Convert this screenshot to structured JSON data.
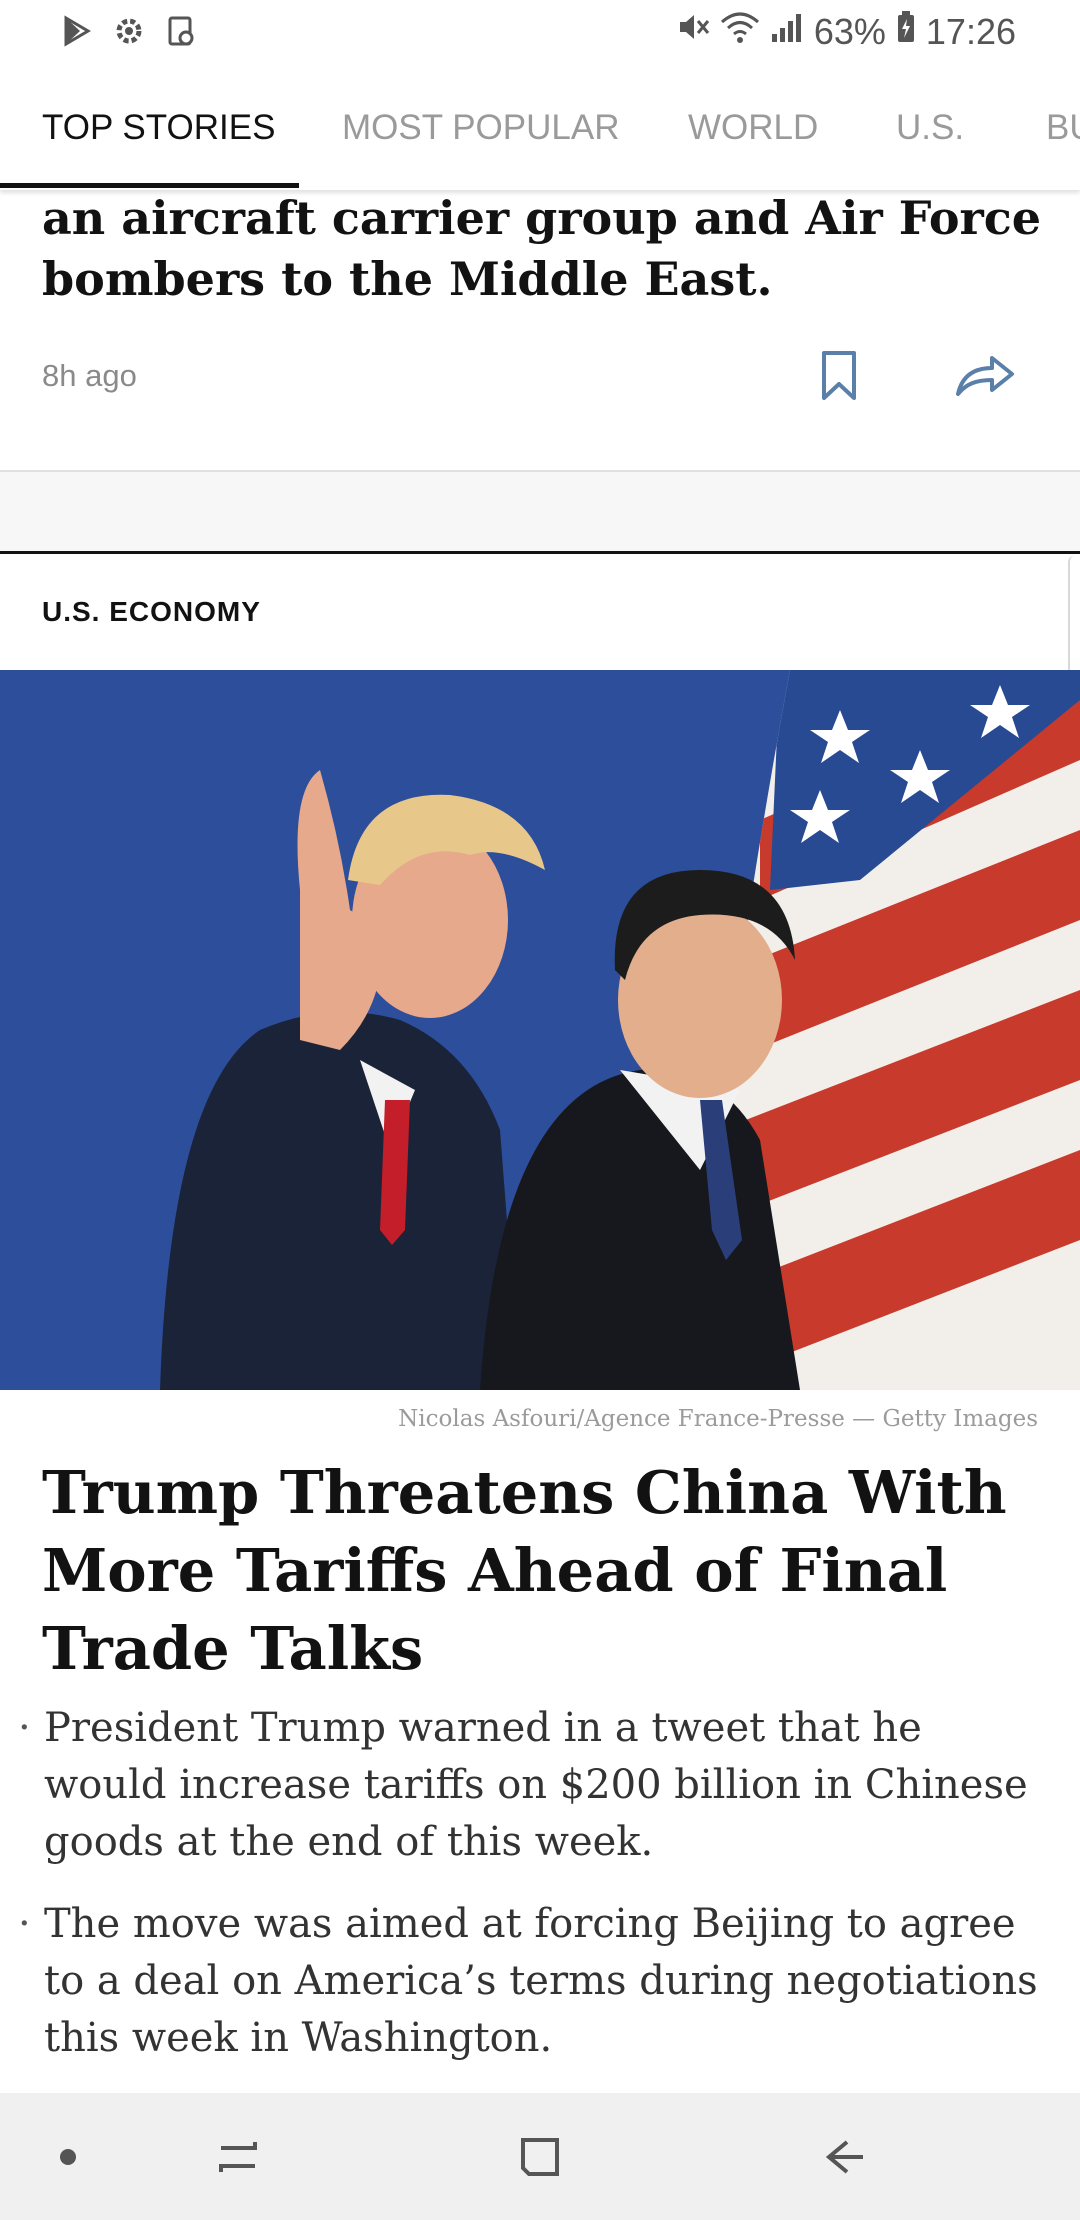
{
  "status_bar": {
    "left_icons": [
      "play-store-icon",
      "settings-gear-icon",
      "file-icon"
    ],
    "right_icons": [
      "mute-icon",
      "wifi-icon",
      "signal-icon"
    ],
    "battery": "63%",
    "time": "17:26"
  },
  "tabs": [
    {
      "label": "TOP STORIES",
      "active": true
    },
    {
      "label": "MOST POPULAR",
      "active": false
    },
    {
      "label": "WORLD",
      "active": false
    },
    {
      "label": "U.S.",
      "active": false
    },
    {
      "label": "BU",
      "active": false
    }
  ],
  "prev_article": {
    "headline_fragment": "an aircraft carrier group and Air Force bombers to the Middle East.",
    "time": "8h ago"
  },
  "article": {
    "section": "U.S. ECONOMY",
    "photo_credit": "Nicolas Asfouri/Agence France-Presse — Getty Images",
    "headline": "Trump Threatens China With More Tariffs Ahead of Final Trade Talks",
    "bullets": [
      "President Trump warned in a tweet that he would increase tariffs on $200 billion in Chinese goods at the end of this week.",
      "The move was aimed at forcing Beijing to agree to a deal on America’s terms during negotiations this week in Washington."
    ],
    "bullet_char": "·"
  },
  "nav_bar": {
    "items": [
      "dot-icon",
      "recents-icon",
      "home-icon",
      "back-icon"
    ]
  },
  "colors": {
    "text": "#121212",
    "muted": "#8a8a8a",
    "icon_blue": "#5a7fa8",
    "photo_background": "#2e4f9c",
    "navbar_bg": "#f0f0f0"
  }
}
